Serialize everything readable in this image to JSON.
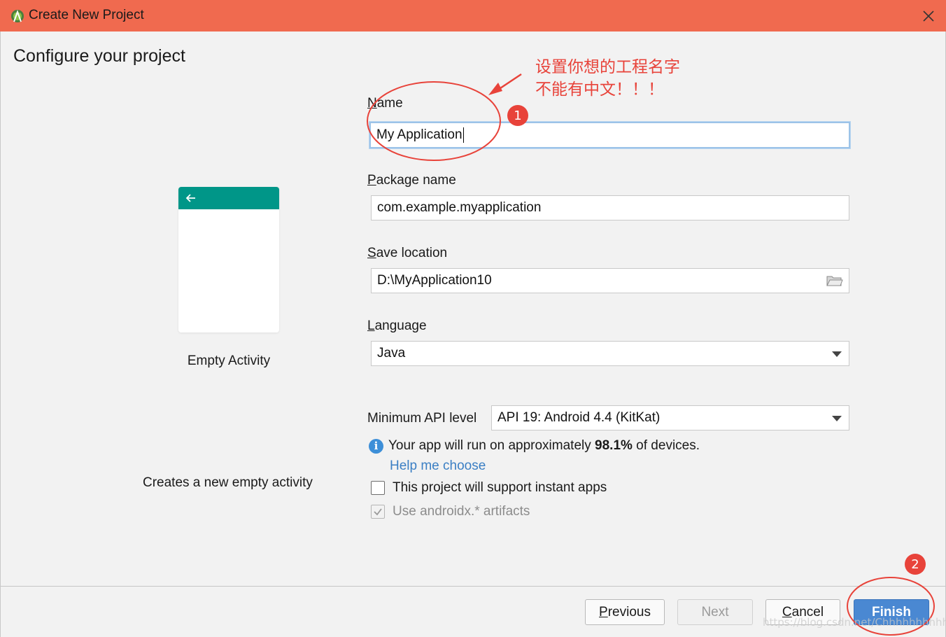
{
  "window": {
    "title": "Create New Project",
    "app_icon": "android-studio-icon",
    "close_icon": "close-icon"
  },
  "page": {
    "heading": "Configure your project"
  },
  "template": {
    "name": "Empty Activity",
    "description": "Creates a new empty activity",
    "toolbar_color": "#009688",
    "back_icon": "arrow-left-icon"
  },
  "form": {
    "name": {
      "label_mnemonic": "N",
      "label_rest": "ame",
      "value": "My Application"
    },
    "package": {
      "label_mnemonic": "P",
      "label_rest": "ackage name",
      "value": "com.example.myapplication"
    },
    "save_location": {
      "label_mnemonic": "S",
      "label_rest": "ave location",
      "value": "D:\\MyApplication10",
      "icon": "folder-icon"
    },
    "language": {
      "label_mnemonic": "L",
      "label_rest": "anguage",
      "value": "Java"
    },
    "min_api": {
      "label": "Minimum API level",
      "value": "API 19: Android 4.4 (KitKat)"
    },
    "info": {
      "prefix": "Your app will run on approximately ",
      "percent": "98.1%",
      "suffix": " of devices.",
      "help_link": "Help me choose"
    },
    "instant_apps": {
      "label": "This project will support instant apps",
      "checked": false
    },
    "androidx": {
      "label": "Use androidx.* artifacts",
      "checked": true,
      "disabled": true
    }
  },
  "buttons": {
    "previous_mnemonic": "P",
    "previous_rest": "revious",
    "next": "Next",
    "cancel_mnemonic": "C",
    "cancel_rest": "ancel",
    "finish": "Finish"
  },
  "annotations": {
    "line1": "设置你想的工程名字",
    "line2": "不能有中文！！！",
    "badge1": "1",
    "badge2": "2",
    "color": "#e8433a"
  },
  "watermark": "https://blog.csdn.net/Chhhhhhhhhhh"
}
